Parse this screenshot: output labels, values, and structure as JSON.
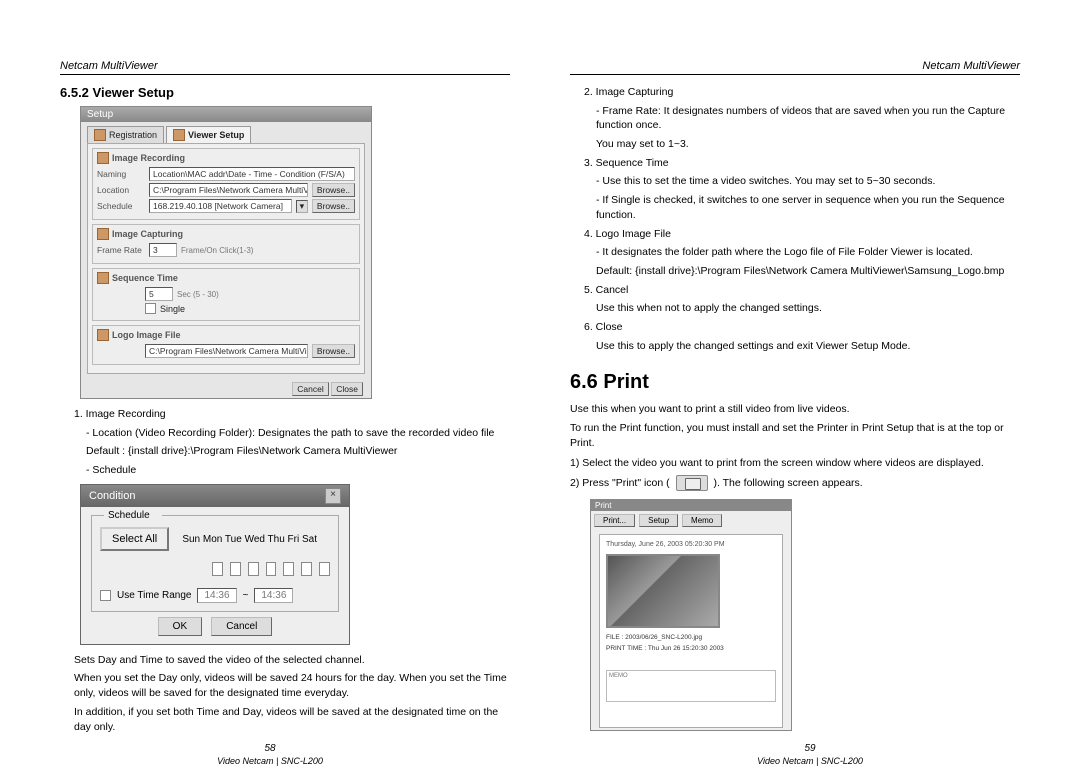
{
  "left": {
    "header": "Netcam MultiViewer",
    "section_num_title": "6.5.2 Viewer Setup",
    "setup": {
      "title": "Setup",
      "tab1": "Registration",
      "tab2": "Viewer Setup",
      "grp_recording": "Image Recording",
      "naming_lbl": "Naming",
      "naming_val": "Location\\MAC addr\\Date - Time - Condition (F/S/A)",
      "location_lbl": "Location",
      "location_val": "C:\\Program Files\\Network Camera MultiViewer",
      "browse": "Browse..",
      "schedule_lbl": "Schedule",
      "schedule_val": "168.219.40.108 [Network Camera]",
      "grp_capture": "Image Capturing",
      "framerate_lbl": "Frame Rate",
      "framerate_val": "3",
      "framerate_hint": "Frame/On Click(1-3)",
      "grp_seq": "Sequence Time",
      "seq_val": "5",
      "seq_hint": "Sec (5 - 30)",
      "single": "Single",
      "grp_logo": "Logo Image File",
      "logo_val": "C:\\Program Files\\Network Camera MultiViewer\\Sam",
      "btn1": "Cancel",
      "btn2": "Close"
    },
    "text1": "1. Image Recording",
    "text1a": "- Location (Video Recording Folder): Designates the path to save the recorded video file",
    "text1b": "Default : {install drive}:\\Program Files\\Network Camera MultiViewer",
    "text1c": "- Schedule",
    "cond": {
      "title": "Condition",
      "schedule": "Schedule",
      "select_all": "Select All",
      "days": "Sun Mon Tue Wed Thu Fri Sat",
      "use_time": "Use Time Range",
      "t1": "14:36",
      "tilde": "~",
      "t2": "14:36",
      "ok": "OK",
      "cancel": "Cancel"
    },
    "text2": "Sets Day and Time to saved the video of the selected channel.",
    "text3": "When you set the Day only, videos will be saved 24 hours for the day. When you set the Time only, videos will be saved for the designated time everyday.",
    "text4": "In addition, if you set both Time and Day, videos will be saved at the designated time on the day only.",
    "page_num": "58",
    "footer_model": "Video Netcam | SNC-L200"
  },
  "right": {
    "header": "Netcam MultiViewer",
    "i2": "2. Image Capturing",
    "i2a": "- Frame Rate: It designates numbers of videos that are saved when you run the Capture function once.",
    "i2b": "You may set to 1~3.",
    "i3": "3. Sequence Time",
    "i3a": "- Use this to set the time a video switches. You may set to 5~30 seconds.",
    "i3b": "- If Single is checked, it switches to one server in sequence when you run the Sequence function.",
    "i4": "4. Logo Image File",
    "i4a": "- It designates the folder path where the Logo file of File Folder Viewer is located.",
    "i4b": "Default: {install drive}:\\Program Files\\Network Camera MultiViewer\\Samsung_Logo.bmp",
    "i5": "5. Cancel",
    "i5a": "Use this when not to apply the changed settings.",
    "i6": "6. Close",
    "i6a": "Use this to apply the changed settings and exit Viewer Setup Mode.",
    "chapter": "6.6 Print",
    "p1": "Use this when you want to print a still video from live videos.",
    "p2": "To run the Print function, you must install and set the Printer in Print Setup that is at the top or Print.",
    "p3": "1) Select the video you want to print from the screen window where videos are displayed.",
    "p4a": "2) Press \"Print\" icon (",
    "p4b": "). The following screen appears.",
    "print_prev": {
      "bar": "Print",
      "b1": "Print...",
      "b2": "Setup",
      "b3": "Memo",
      "stamp": "Thursday, June 26, 2003 05:20:30 PM",
      "meta1": "FILE : 2003/06/26_SNC-L200.jpg",
      "meta2": "PRINT TIME : Thu Jun 26 15:20:30 2003",
      "memo": "MEMO"
    },
    "page_num": "59",
    "footer_model": "Video Netcam | SNC-L200"
  }
}
